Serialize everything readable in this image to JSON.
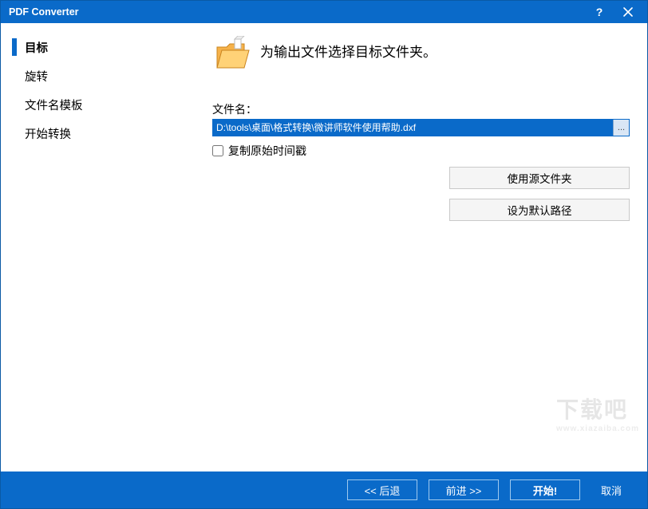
{
  "window": {
    "title": "PDF Converter"
  },
  "sidebar": {
    "items": [
      {
        "label": "目标",
        "active": true
      },
      {
        "label": "旋转",
        "active": false
      },
      {
        "label": "文件名模板",
        "active": false
      },
      {
        "label": "开始转换",
        "active": false
      }
    ]
  },
  "content": {
    "heading": "为输出文件选择目标文件夹。",
    "filename_label": "文件名：",
    "filename_value": "D:\\tools\\桌面\\格式转换\\微讲师软件使用帮助.dxf",
    "browse_label": "...",
    "copy_timestamp_label": "复制原始时间戳",
    "buttons": {
      "use_source": "使用源文件夹",
      "set_default": "设为默认路径"
    }
  },
  "footer": {
    "back": "<<  后退",
    "next": "前进  >>",
    "start": "开始!",
    "cancel": "取消"
  },
  "watermark": {
    "main": "下载吧",
    "sub": "www.xiazaiba.com"
  },
  "colors": {
    "accent": "#0a6ac9"
  }
}
